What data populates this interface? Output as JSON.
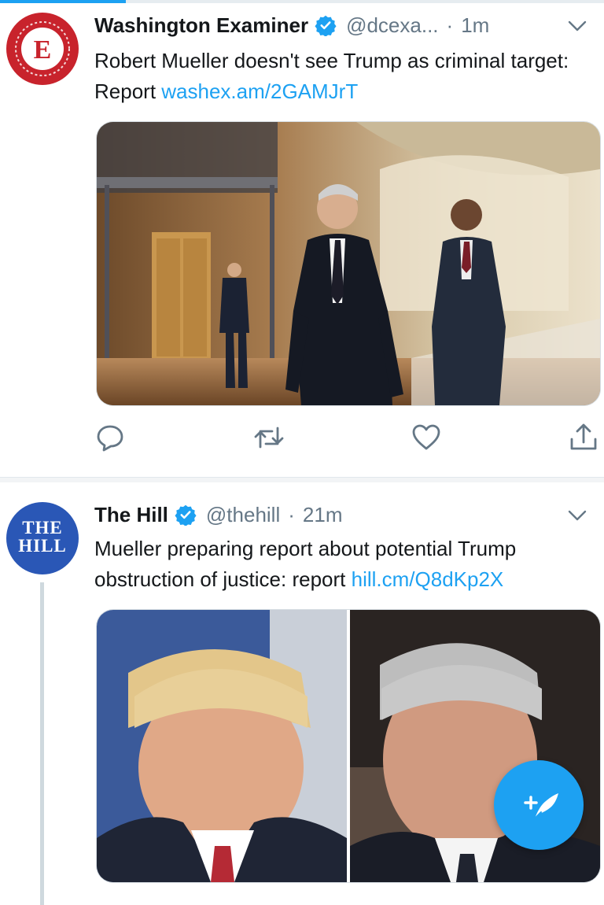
{
  "tweets": [
    {
      "author": {
        "name": "Washington Examiner",
        "handle": "@dcexa...",
        "time": "1m",
        "avatar_icon": "washington-examiner-logo"
      },
      "body": "Robert Mueller doesn't see Trump as criminal target: Report ",
      "link": "washex.am/2GAMJrT",
      "media": "photo"
    },
    {
      "author": {
        "name": "The Hill",
        "handle": "@thehill",
        "time": "21m",
        "avatar_text_line1": "THE",
        "avatar_text_line2": "HILL"
      },
      "body": "Mueller preparing report about potential Trump obstruction of justice: report ",
      "link": "hill.cm/Q8dKp2X",
      "media": "two-photo-grid"
    }
  ],
  "separator": "·",
  "actions": [
    "reply-icon",
    "retweet-icon",
    "like-icon",
    "share-icon"
  ],
  "compose_button": {
    "icon": "compose-feather-icon"
  },
  "colors": {
    "accent": "#1da1f2",
    "text": "#14171a",
    "secondary": "#657786",
    "we_red": "#c8232c",
    "hill_blue": "#2a57b6"
  }
}
